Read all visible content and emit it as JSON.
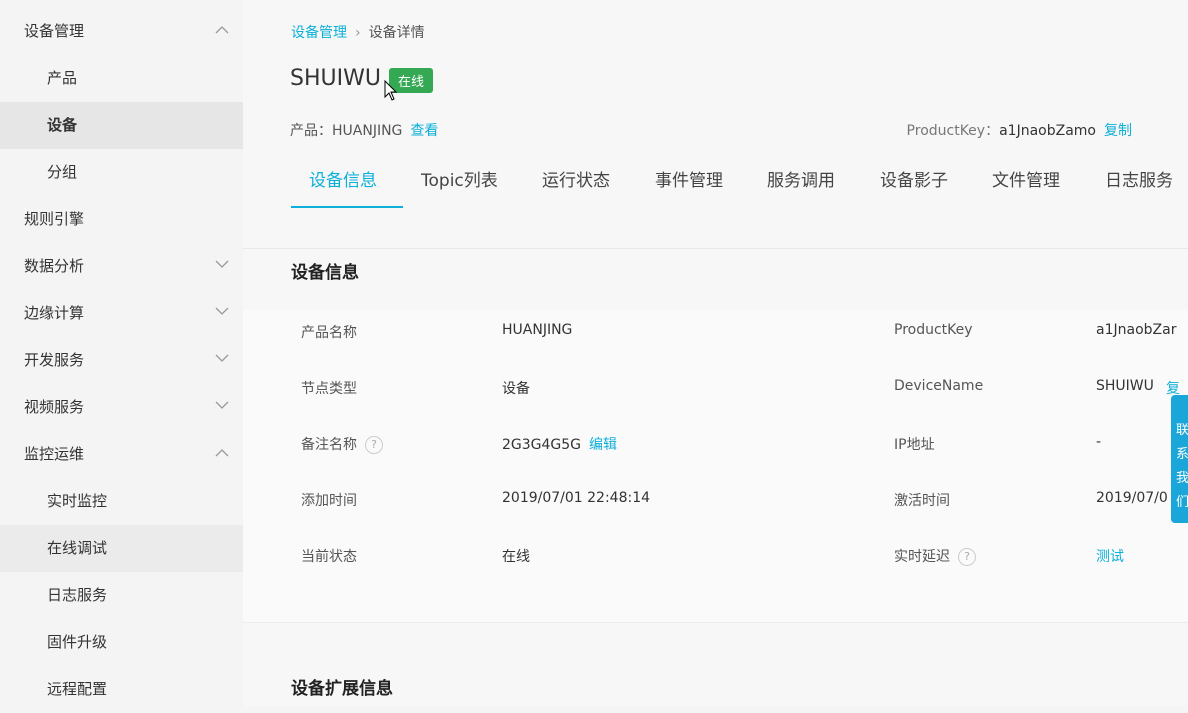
{
  "sidebar": {
    "items": [
      {
        "label": "设备管理",
        "expanded": true
      },
      {
        "label": "产品"
      },
      {
        "label": "设备",
        "active": true
      },
      {
        "label": "分组"
      },
      {
        "label": "规则引擎"
      },
      {
        "label": "数据分析"
      },
      {
        "label": "边缘计算"
      },
      {
        "label": "开发服务"
      },
      {
        "label": "视频服务"
      },
      {
        "label": "监控运维",
        "expanded": true
      },
      {
        "label": "实时监控"
      },
      {
        "label": "在线调试"
      },
      {
        "label": "日志服务"
      },
      {
        "label": "固件升级"
      },
      {
        "label": "远程配置"
      }
    ]
  },
  "breadcrumb": {
    "root": "设备管理",
    "current": "设备详情"
  },
  "device": {
    "name": "SHUIWU",
    "status_badge": "在线",
    "product_prefix": "产品：",
    "product_name": "HUANJING",
    "view_link": "查看",
    "productkey_label": "ProductKey：",
    "productkey_value": "a1JnaobZamo",
    "copy_link": "复制"
  },
  "tabs": [
    "设备信息",
    "Topic列表",
    "运行状态",
    "事件管理",
    "服务调用",
    "设备影子",
    "文件管理",
    "日志服务"
  ],
  "section1": {
    "title": "设备信息",
    "rows": [
      {
        "l1": "产品名称",
        "v1": "HUANJING",
        "l2": "ProductKey",
        "v2": "a1JnaobZar"
      },
      {
        "l1": "节点类型",
        "v1": "设备",
        "l2": "DeviceName",
        "v2": "SHUIWU"
      },
      {
        "l1": "备注名称",
        "v1": "2G3G4G5G",
        "v1_link": "编辑",
        "l2": "IP地址",
        "v2": "-"
      },
      {
        "l1": "添加时间",
        "v1": "2019/07/01 22:48:14",
        "l2": "激活时间",
        "v2": "2019/07/0"
      },
      {
        "l1": "当前状态",
        "v1": "在线",
        "l2": "实时延迟",
        "v2": "测试"
      }
    ],
    "help_glyph": "?",
    "partial_copy": "复"
  },
  "section2": {
    "title": "设备扩展信息"
  },
  "float_tab": {
    "chars": [
      "联",
      "系",
      "我",
      "们"
    ]
  },
  "colors": {
    "accent": "#0db0d8",
    "badge": "#34a853",
    "float_tab": "#1aa6d8"
  }
}
